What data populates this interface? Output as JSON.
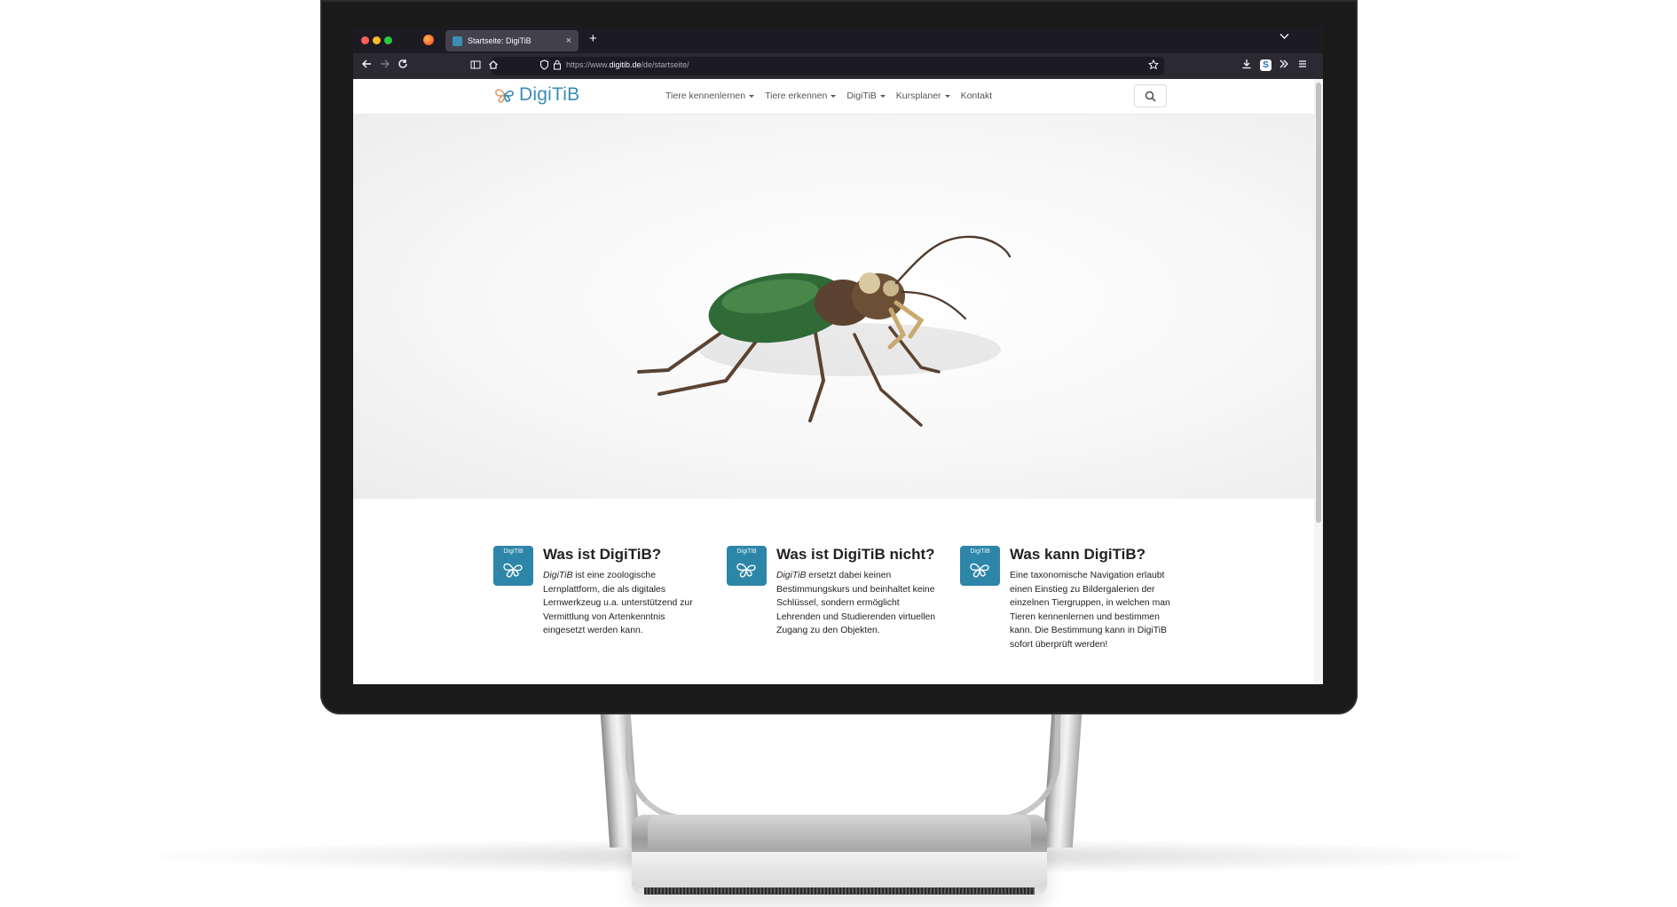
{
  "browser": {
    "tab_title": "Startseite: DigiTiB",
    "tab_close": "×",
    "new_tab": "+",
    "url_prefix": "https://www.",
    "url_domain": "digitib.de",
    "url_path": "/de/startseite/"
  },
  "site": {
    "logo_text": "DigiTiB",
    "nav": [
      {
        "label": "Tiere kennenlernen",
        "dropdown": true
      },
      {
        "label": "Tiere erkennen",
        "dropdown": true
      },
      {
        "label": "DigiTiB",
        "dropdown": true
      },
      {
        "label": "Kursplaner",
        "dropdown": true
      },
      {
        "label": "Kontakt",
        "dropdown": false
      }
    ],
    "brand_color": "#2d86a8"
  },
  "features": [
    {
      "icon_label": "DigiTiB",
      "title": "Was ist DigiTiB?",
      "lead": "DigiTiB",
      "text": " ist eine zoologische Lernplattform, die als digitales Lernwerkzeug u.a. unterstützend zur Vermittlung von Artenkenntnis eingesetzt werden kann."
    },
    {
      "icon_label": "DigiTiB",
      "title": "Was ist DigiTiB nicht?",
      "lead": "DigiTiB",
      "text": " ersetzt dabei keinen Bestimmungskurs und beinhaltet keine Schlüssel, sondern ermöglicht Lehrenden und Studierenden virtuellen Zugang zu den Objekten."
    },
    {
      "icon_label": "DigiTiB",
      "title": "Was kann DigiTiB?",
      "lead": "",
      "text": "Eine taxonomische Navigation erlaubt einen Einstieg zu Bildergalerien der einzelnen Tiergruppen, in welchen man Tieren kennenlernen und bestimmen kann. Die Bestimmung kann in DigiTiB sofort überprüft werden!"
    }
  ]
}
